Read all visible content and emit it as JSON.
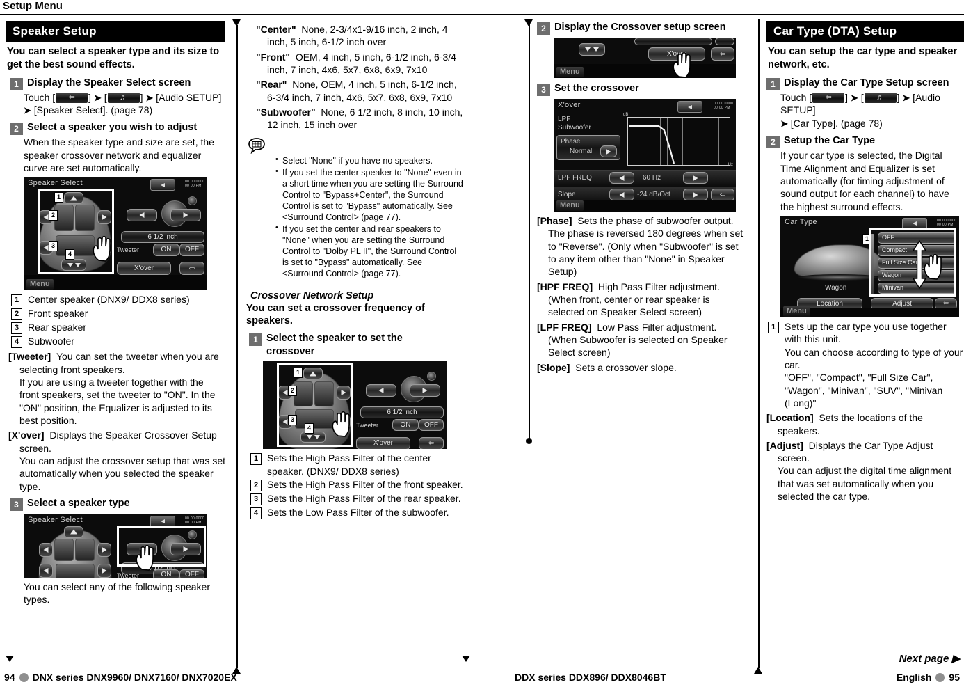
{
  "running_head": {
    "title": "Setup Menu"
  },
  "colors": {
    "header_bar": "#000000",
    "step_badge": "#6e6e6e",
    "page_dot": "#8f8f8f"
  },
  "col1": {
    "section_title": "Speaker Setup",
    "section_intro": "You can select a speaker type and its size to get the best sound effects.",
    "step1": {
      "num": "1",
      "title": "Display the Speaker Select screen",
      "touch_prefix": "Touch [",
      "touch_mid1": "] ",
      "touch_mid2": " [",
      "touch_mid3": "] ",
      "touch_tail": " [Audio SETUP]",
      "touch_line2_arrow": "➤",
      "touch_line2": " [Speaker Select]. (page 78)"
    },
    "step2": {
      "num": "2",
      "title": "Select a speaker you wish to adjust",
      "body": "When the speaker type and size are set, the speaker crossover network and equalizer curve are set automatically.",
      "shot": {
        "title": "Speaker Select",
        "clock_line1": "00 00 0000",
        "clock_line2": "00 00 PM",
        "size_value": "6 1/2 inch",
        "tweeter_label": "Tweeter",
        "on_label": "ON",
        "off_label": "OFF",
        "xover_label": "X'over",
        "menu_label": "Menu",
        "callouts": [
          "1",
          "2",
          "3",
          "4"
        ]
      },
      "callouts": [
        {
          "num": "1",
          "text": "Center speaker (DNX9/ DDX8 series)"
        },
        {
          "num": "2",
          "text": "Front speaker"
        },
        {
          "num": "3",
          "text": "Rear speaker"
        },
        {
          "num": "4",
          "text": "Subwoofer"
        }
      ],
      "terms": [
        {
          "key": "[Tweeter]",
          "text": "You can set the tweeter when you are selecting front speakers.",
          "cont": "If you are using a tweeter together with the front speakers, set the tweeter to \"ON\". In the \"ON\" position, the Equalizer is adjusted to its best position."
        },
        {
          "key": "[X'over]",
          "text": "Displays the Speaker Crossover Setup screen.",
          "cont": "You can adjust the crossover setup that was set automatically when you selected the speaker type."
        }
      ]
    },
    "step3": {
      "num": "3",
      "title": "Select a speaker type",
      "shot": {
        "title": "Speaker Select",
        "clock_line1": "00 00 0000",
        "clock_line2": "00 00 PM",
        "size_value": "6 1/2 inch",
        "tweeter_label": "Tweeter",
        "on_label": "ON",
        "off_label": "OFF"
      },
      "body": "You can select any of the following speaker types."
    }
  },
  "col2": {
    "size_terms": [
      {
        "key": "\"Center\"",
        "text": "None, 2-3/4x1-9/16 inch, 2 inch, 4 inch, 5 inch, 6-1/2 inch over"
      },
      {
        "key": "\"Front\"",
        "text": "OEM, 4 inch, 5 inch, 6-1/2 inch, 6-3/4 inch, 7 inch, 4x6, 5x7, 6x8, 6x9, 7x10"
      },
      {
        "key": "\"Rear\"",
        "text": "None, OEM, 4 inch, 5 inch, 6-1/2 inch, 6-3/4 inch, 7 inch, 4x6, 5x7, 6x8, 6x9, 7x10"
      },
      {
        "key": "\"Subwoofer\"",
        "text": "None, 6 1/2 inch, 8 inch, 10 inch, 12 inch, 15 inch over"
      }
    ],
    "notes": [
      "Select \"None\" if you have no speakers.",
      "If you set the center speaker to \"None\" even in a short time when you are setting the Surround Control to \"Bypass+Center\", the Surround Control is set to \"Bypass\" automatically. See <Surround Control> (page 77).",
      "If you set the center and rear speakers to \"None\" when you are setting the Surround Control to \"Dolby PL II\", the Surround Control is set to \"Bypass\" automatically. See <Surround Control> (page 77)."
    ],
    "sub_head": "Crossover Network Setup",
    "sub_intro": "You can set a crossover frequency of speakers.",
    "step1": {
      "num": "1",
      "title": "Select the speaker to set the crossover",
      "shot": {
        "size_value": "6 1/2 inch",
        "tweeter_label": "Tweeter",
        "on_label": "ON",
        "off_label": "OFF",
        "xover_label": "X'over",
        "callouts": [
          "1",
          "2",
          "3",
          "4"
        ]
      },
      "callouts": [
        {
          "num": "1",
          "text": "Sets the High Pass Filter of the center speaker. (DNX9/ DDX8 series)"
        },
        {
          "num": "2",
          "text": "Sets the High Pass Filter of the front speaker."
        },
        {
          "num": "3",
          "text": "Sets the High Pass Filter of the rear speaker."
        },
        {
          "num": "4",
          "text": "Sets the Low Pass Filter of the subwoofer."
        }
      ]
    }
  },
  "col3": {
    "step2": {
      "num": "2",
      "title": "Display the Crossover setup screen",
      "shot": {
        "xover_label": "X'over",
        "menu_label": "Menu"
      }
    },
    "step3": {
      "num": "3",
      "title": "Set the crossover",
      "shot": {
        "title": "X'over",
        "clock_line1": "00 00 0000",
        "clock_line2": "00 00 PM",
        "lpf_label": "LPF",
        "subwoofer_label": "Subwoofer",
        "phase_label": "Phase",
        "phase_value": "Normal",
        "lpf_freq_label": "LPF FREQ",
        "lpf_freq_value": "60 Hz",
        "slope_label": "Slope",
        "slope_value": "-24 dB/Oct",
        "menu_label": "Menu",
        "axis_db": "dB",
        "axis_hz": "Hz"
      }
    },
    "terms": [
      {
        "key": "[Phase]",
        "text": "Sets the phase of subwoofer output.",
        "cont": "The phase is reversed 180 degrees when set to \"Reverse\". (Only when \"Subwoofer\" is set to any item other than \"None\" in Speaker Setup)"
      },
      {
        "key": "[HPF FREQ]",
        "text": "High Pass Filter adjustment. (When front, center or rear speaker is selected on Speaker Select screen)",
        "cont": ""
      },
      {
        "key": "[LPF FREQ]",
        "text": "Low Pass Filter adjustment. (When Subwoofer is selected on Speaker Select screen)",
        "cont": ""
      },
      {
        "key": "[Slope]",
        "text": "Sets a crossover slope.",
        "cont": ""
      }
    ]
  },
  "col4": {
    "section_title": "Car Type (DTA) Setup",
    "section_intro": "You can setup the car type and speaker network, etc.",
    "step1": {
      "num": "1",
      "title": "Display the Car Type Setup screen",
      "touch_prefix": "Touch [",
      "touch_tail": " [Audio SETUP]",
      "touch_line2": " [Car Type]. (page 78)"
    },
    "step2": {
      "num": "2",
      "title": "Setup the Car Type",
      "body": "If your car type is selected, the Digital Time Alignment and Equalizer is set automatically (for timing adjustment of sound output for each channel) to have the highest surround effects.",
      "shot": {
        "title": "Car Type",
        "clock_line1": "00 00 0000",
        "clock_line2": "00 00 PM",
        "car_label": "Wagon",
        "location_label": "Location",
        "adjust_label": "Adjust",
        "menu_label": "Menu",
        "callout": "1",
        "list": [
          "OFF",
          "Compact",
          "Full Size Car",
          "Wagon",
          "Minivan"
        ]
      }
    },
    "callouts": [
      {
        "num": "1",
        "text": "Sets up the car type you use together with this unit.",
        "cont1": "You can choose according to type of your car.",
        "cont2": "\"OFF\", \"Compact\", \"Full Size Car\", \"Wagon\", \"Minivan\", \"SUV\", \"Minivan (Long)\""
      }
    ],
    "terms": [
      {
        "key": "[Location]",
        "text": "Sets the locations of the speakers.",
        "cont": ""
      },
      {
        "key": "[Adjust]",
        "text": "Displays the Car Type Adjust screen.",
        "cont": "You can adjust the digital time alignment that was set automatically when you selected the car type."
      }
    ]
  },
  "footer": {
    "page_left": "94",
    "left_text": "DNX series  DNX9960/ DNX7160/ DNX7020EX",
    "center_text": "DDX series  DDX896/ DDX8046BT",
    "right_lang": "English",
    "page_right": "95",
    "next_page": "Next page ▶"
  }
}
